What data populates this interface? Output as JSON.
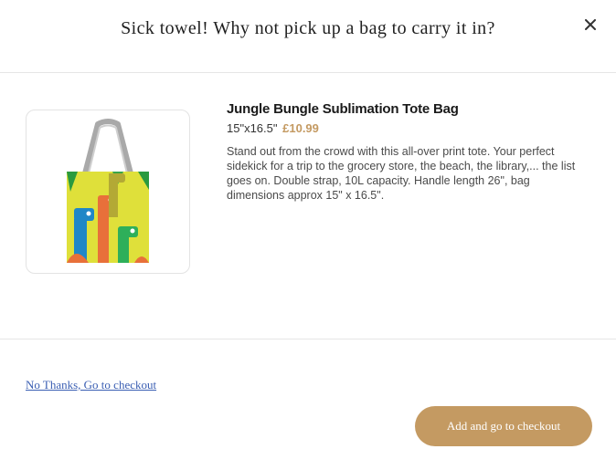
{
  "header": {
    "title": "Sick towel! Why not pick up a bag to carry it in?",
    "close_icon": "close-icon"
  },
  "product": {
    "name": "Jungle Bungle Sublimation Tote Bag",
    "size": "15\"x16.5\"",
    "price": "£10.99",
    "description": "Stand out from the crowd with this all-over print tote. Your perfect sidekick for a trip to the grocery store, the beach, the library,... the list goes on. Double strap, 10L capacity. Handle length 26\", bag dimensions approx 15\" x 16.5\"."
  },
  "footer": {
    "decline_label": "No Thanks, Go to checkout",
    "accept_label": "Add and go to checkout"
  },
  "colors": {
    "accent": "#c49a62",
    "link": "#3b5fb3"
  }
}
